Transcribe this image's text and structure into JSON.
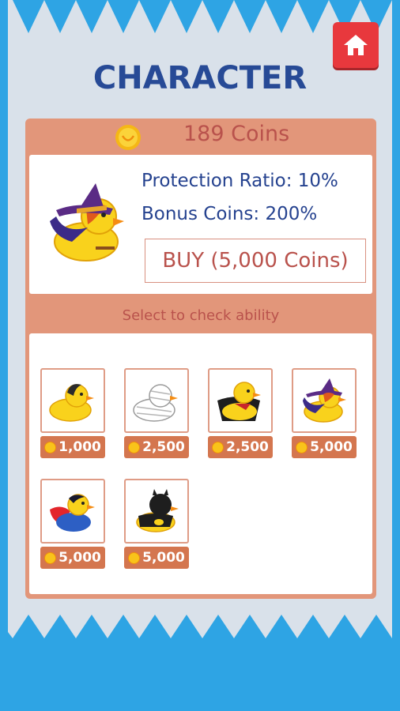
{
  "header": {
    "title": "CHARACTER",
    "home_button": "home-icon"
  },
  "wallet": {
    "coins_label": "189 Coins",
    "icon": "coin-icon"
  },
  "selected_character": {
    "protection_ratio": "Protection Ratio:  10%",
    "bonus_coins": "Bonus Coins:  200%",
    "buy_label": "BUY (5,000 Coins)"
  },
  "hint": "Select to check ability",
  "characters": [
    {
      "name": "black-hair-duck",
      "price": "1,000"
    },
    {
      "name": "mummy-duck",
      "price": "2,500"
    },
    {
      "name": "vampire-duck",
      "price": "2,500"
    },
    {
      "name": "witch-duck",
      "price": "5,000"
    },
    {
      "name": "superhero-duck",
      "price": "5,000"
    },
    {
      "name": "batman-duck",
      "price": "5,000"
    }
  ],
  "colors": {
    "background": "#2ea4e4",
    "paper": "#d9e1ea",
    "panel": "#e2967a",
    "title": "#274a96",
    "home": "#e8383d",
    "price_tag": "#d4764f"
  }
}
